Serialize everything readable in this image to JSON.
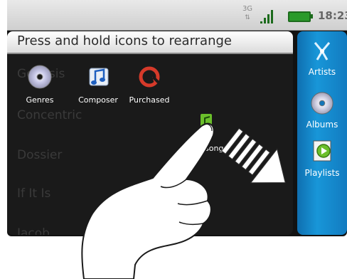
{
  "status_bar": {
    "network": "3G",
    "time": "18:23"
  },
  "panel": {
    "header": "Press and hold icons to rearrange",
    "list_items": [
      "Genesis",
      "Concentric",
      "Dossier",
      "If It Is",
      "Jacob"
    ]
  },
  "tiles": [
    {
      "label": "Genres",
      "icon": "disc-icon"
    },
    {
      "label": "Composer",
      "icon": "music-note-icon"
    },
    {
      "label": "Purchased",
      "icon": "purchased-icon"
    }
  ],
  "dragged_item": {
    "label": "songs",
    "icon": "music-note-icon"
  },
  "sidebar": {
    "items": [
      {
        "label": "Artists",
        "icon": "artists-icon"
      },
      {
        "label": "Albums",
        "icon": "disc-icon"
      },
      {
        "label": "Playlists",
        "icon": "playlist-icon"
      }
    ]
  },
  "colors": {
    "sidebar": "#1896d8",
    "accent_green": "#6bbf2b",
    "purchased_red": "#d63a2a"
  }
}
